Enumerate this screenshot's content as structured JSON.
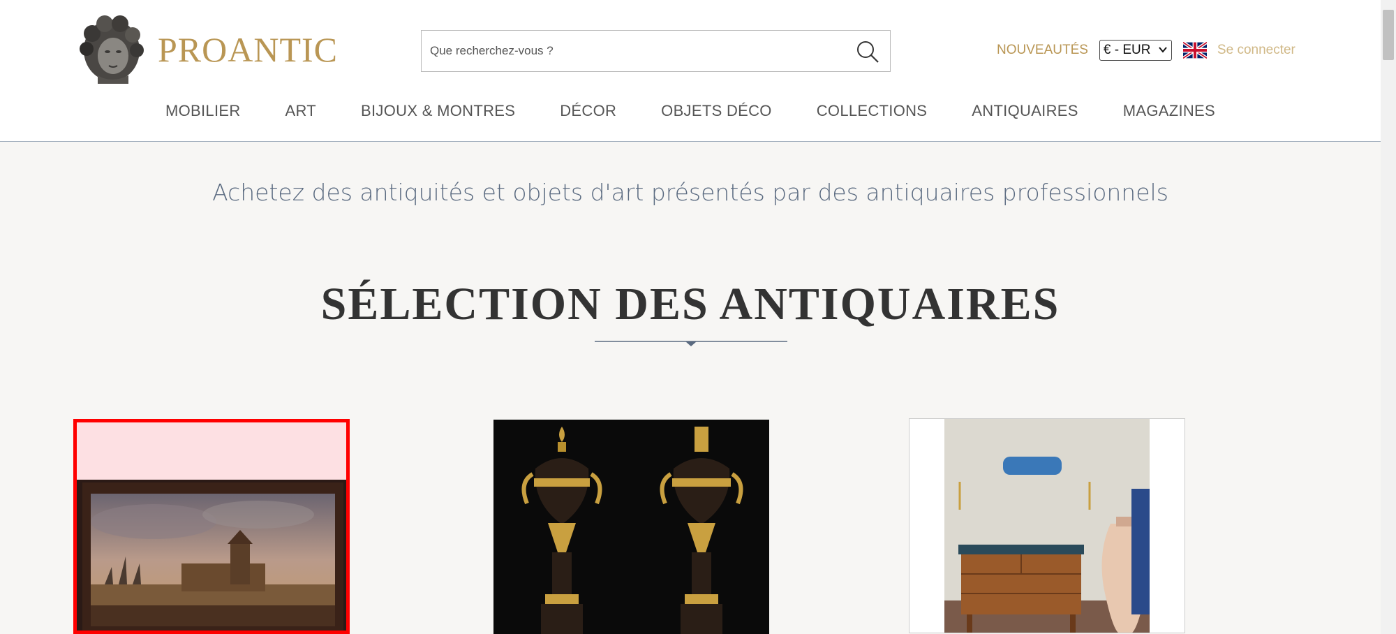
{
  "header": {
    "logo_text": "PROANTIC",
    "search": {
      "placeholder": "Que recherchez-vous ?",
      "value": ""
    },
    "news_label": "NOUVEAUTÉS",
    "currency_selected": "€ - EUR",
    "language_flag": "uk-flag-icon",
    "login_label": "Se connecter"
  },
  "nav": {
    "items": [
      {
        "label": "MOBILIER"
      },
      {
        "label": "ART"
      },
      {
        "label": "BIJOUX & MONTRES"
      },
      {
        "label": "DÉCOR"
      },
      {
        "label": "OBJETS DÉCO"
      },
      {
        "label": "COLLECTIONS"
      },
      {
        "label": "ANTIQUAIRES"
      },
      {
        "label": "MAGAZINES"
      }
    ]
  },
  "main": {
    "tagline": "Achetez des antiquités et objets d'art présentés par des antiquaires professionnels",
    "section_title": "SÉLECTION DES ANTIQUAIRES",
    "cards": [
      {
        "image": "landscape-painting"
      },
      {
        "image": "bronze-urns"
      },
      {
        "image": "commode-room"
      }
    ]
  },
  "colors": {
    "brand_gold": "#b99654",
    "login_gold": "#d0b886",
    "tagline_blue": "#5a6a80",
    "highlight_red": "#ff0000"
  }
}
